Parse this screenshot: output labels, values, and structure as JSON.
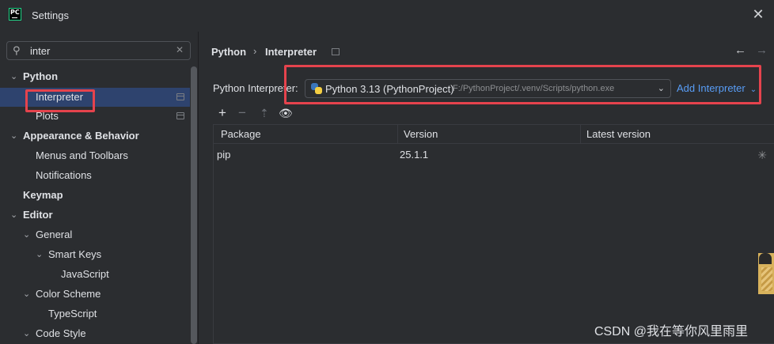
{
  "window": {
    "title": "Settings"
  },
  "sidebar": {
    "search_value": "inter",
    "items": [
      {
        "label": "Python",
        "bold": true,
        "chevron": "down"
      },
      {
        "label": "Interpreter",
        "selected": true,
        "project_icon": true
      },
      {
        "label": "Plots",
        "project_icon": true
      },
      {
        "label": "Appearance & Behavior",
        "bold": true,
        "chevron": "down"
      },
      {
        "label": "Menus and Toolbars"
      },
      {
        "label": "Notifications"
      },
      {
        "label": "Keymap",
        "bold": true
      },
      {
        "label": "Editor",
        "bold": true,
        "chevron": "down"
      },
      {
        "label": "General",
        "chevron": "down"
      },
      {
        "label": "Smart Keys",
        "chevron": "down"
      },
      {
        "label": "JavaScript"
      },
      {
        "label": "Color Scheme",
        "chevron": "down"
      },
      {
        "label": "TypeScript"
      },
      {
        "label": "Code Style",
        "chevron": "down"
      }
    ]
  },
  "main": {
    "breadcrumb": [
      "Python",
      "Interpreter"
    ],
    "interpreter_label": "Python Interpreter:",
    "interpreter_name": "Python 3.13 (PythonProject)",
    "interpreter_path": "F:/PythonProject/.venv/Scripts/python.exe",
    "add_interpreter": "Add Interpreter",
    "table": {
      "columns": [
        "Package",
        "Version",
        "Latest version"
      ],
      "rows": [
        {
          "package": "pip",
          "version": "25.1.1",
          "latest": ""
        }
      ]
    }
  },
  "watermark": "CSDN @我在等你风里雨里",
  "colors": {
    "background": "#2b2d30",
    "selection": "#2e436e",
    "link": "#589df6",
    "highlight_box": "#e5434d"
  }
}
